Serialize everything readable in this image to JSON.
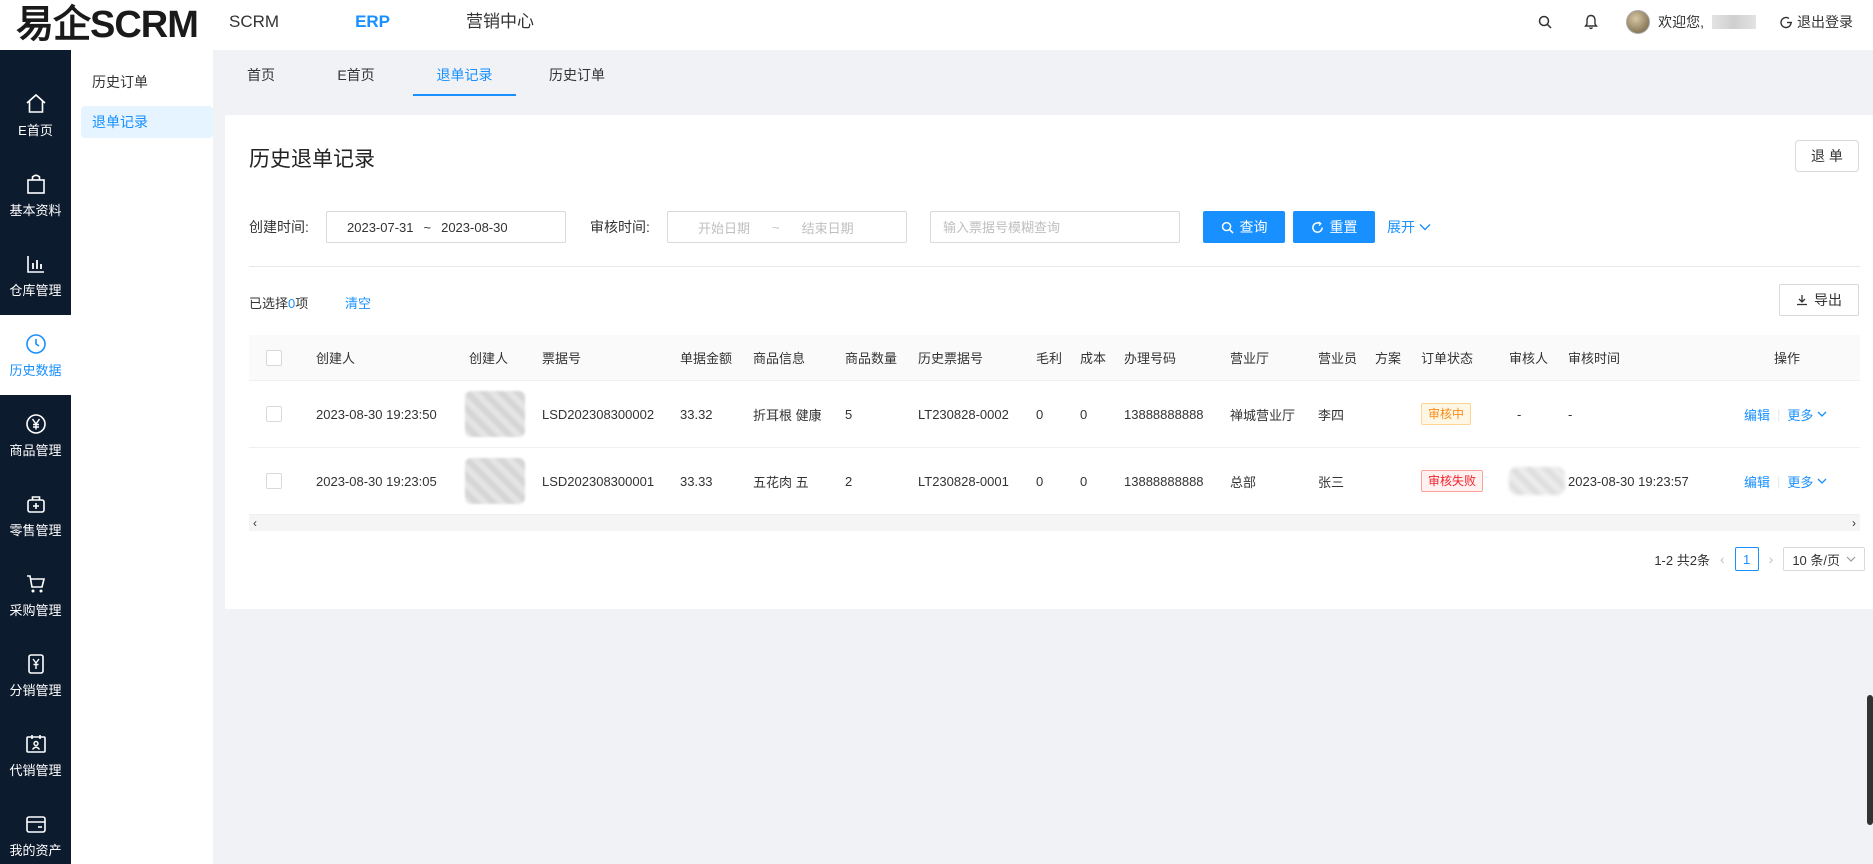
{
  "header": {
    "logo": "易企SCRM",
    "nav": [
      "SCRM",
      "ERP",
      "营销中心"
    ],
    "welcome": "欢迎您,",
    "logout": "退出登录"
  },
  "sidebar": {
    "items": [
      {
        "label": "E首页",
        "icon": "home-icon"
      },
      {
        "label": "基本资料",
        "icon": "bag-icon"
      },
      {
        "label": "仓库管理",
        "icon": "bar-chart-icon"
      },
      {
        "label": "历史数据",
        "icon": "clock-icon"
      },
      {
        "label": "商品管理",
        "icon": "yen-icon"
      },
      {
        "label": "零售管理",
        "icon": "store-icon"
      },
      {
        "label": "采购管理",
        "icon": "cart-icon"
      },
      {
        "label": "分销管理",
        "icon": "distribution-icon"
      },
      {
        "label": "代销管理",
        "icon": "consign-icon"
      },
      {
        "label": "我的资产",
        "icon": "wallet-icon"
      }
    ]
  },
  "submenu": {
    "items": [
      "历史订单",
      "退单记录"
    ]
  },
  "tabs": [
    "首页",
    "E首页",
    "退单记录",
    "历史订单"
  ],
  "main": {
    "title": "历史退单记录",
    "return_button": "退 单",
    "filters": {
      "created_label": "创建时间:",
      "created_start": "2023-07-31",
      "created_sep": "~",
      "created_end": "2023-08-30",
      "audit_label": "审核时间:",
      "audit_start_placeholder": "开始日期",
      "audit_sep": "~",
      "audit_end_placeholder": "结束日期",
      "search_placeholder": "输入票据号模糊查询",
      "query_button": "查询",
      "reset_button": "重置",
      "expand": "展开"
    },
    "selection": {
      "prefix": "已选择",
      "count": "0",
      "suffix": "项",
      "clear": "清空"
    },
    "export_button": "导出",
    "table": {
      "headers": [
        "创建人",
        "创建人",
        "票据号",
        "单据金额",
        "商品信息",
        "商品数量",
        "历史票据号",
        "毛利",
        "成本",
        "办理号码",
        "营业厅",
        "营业员",
        "方案",
        "订单状态",
        "审核人",
        "审核时间",
        "操作"
      ],
      "rows": [
        {
          "created_at": "2023-08-30 19:23:50",
          "ticket_no": "LSD202308300002",
          "amount": "33.32",
          "goods": "折耳根 健康",
          "qty": "5",
          "history_no": "LT230828-0002",
          "profit": "0",
          "cost": "0",
          "phone": "13888888888",
          "hall": "禅城营业厅",
          "clerk": "李四",
          "plan": "",
          "status": "审核中",
          "auditor": "-",
          "audit_time": "-",
          "edit": "编辑",
          "more": "更多"
        },
        {
          "created_at": "2023-08-30 19:23:05",
          "ticket_no": "LSD202308300001",
          "amount": "33.33",
          "goods": "五花肉 五",
          "qty": "2",
          "history_no": "LT230828-0001",
          "profit": "0",
          "cost": "0",
          "phone": "13888888888",
          "hall": "总部",
          "clerk": "张三",
          "plan": "",
          "status": "审核失败",
          "auditor": "",
          "audit_time": "2023-08-30 19:23:57",
          "edit": "编辑",
          "more": "更多"
        }
      ]
    },
    "pagination": {
      "summary": "1-2 共2条",
      "current": "1",
      "page_size": "10 条/页"
    }
  },
  "colors": {
    "primary": "#1890ff",
    "sidebar_bg": "#0d1b2e",
    "warn": "#fa8c16",
    "error": "#f5222d"
  }
}
